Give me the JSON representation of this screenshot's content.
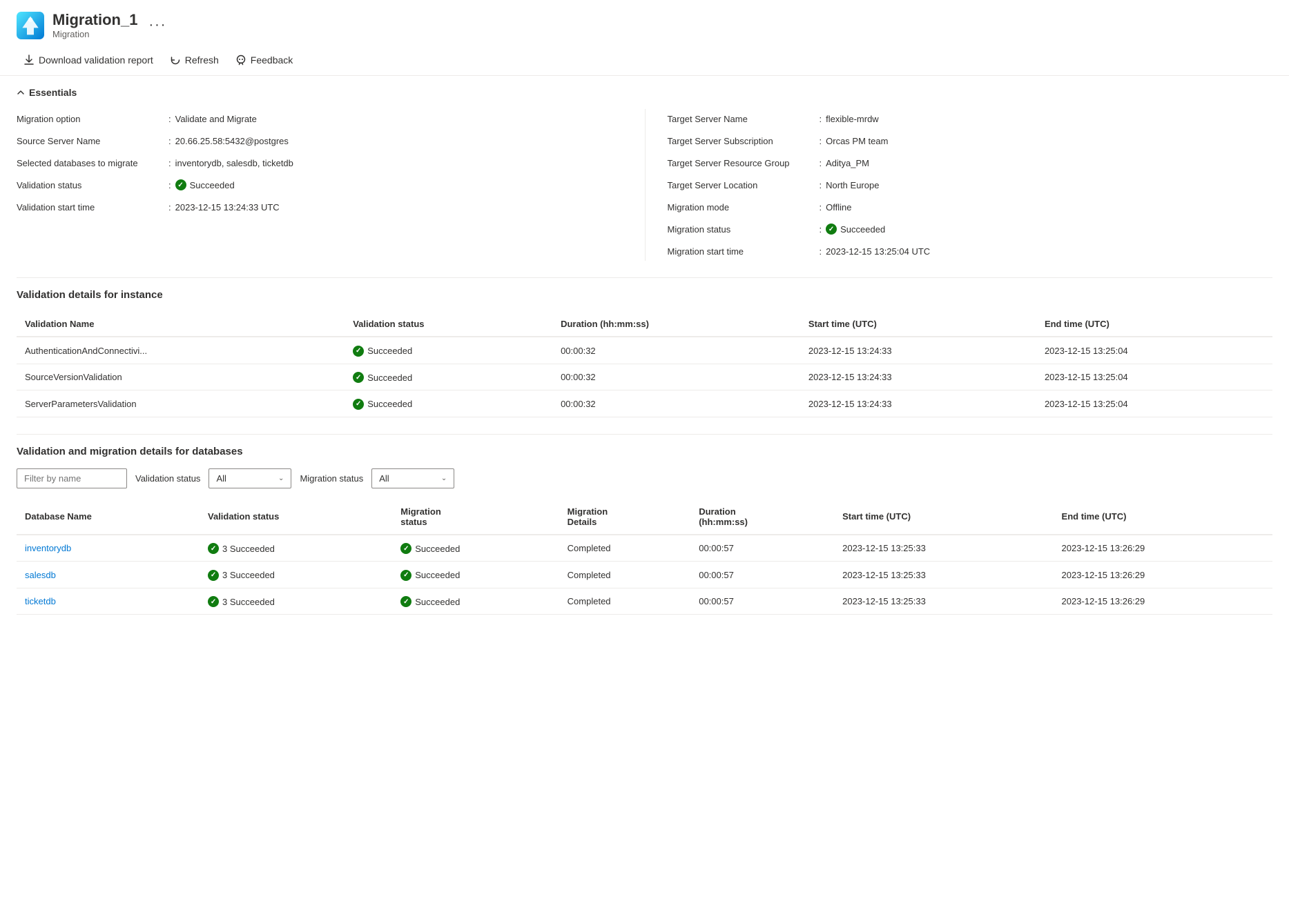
{
  "header": {
    "title": "Migration_1",
    "subtitle": "Migration",
    "ellipsis": "···"
  },
  "toolbar": {
    "download_label": "Download validation report",
    "refresh_label": "Refresh",
    "feedback_label": "Feedback"
  },
  "essentials": {
    "section_label": "Essentials",
    "left": [
      {
        "label": "Migration option",
        "value": "Validate and Migrate"
      },
      {
        "label": "Source Server Name",
        "value": "20.66.25.58:5432@postgres"
      },
      {
        "label": "Selected databases to migrate",
        "value": "inventorydb, salesdb, ticketdb"
      },
      {
        "label": "Validation status",
        "value": "Succeeded",
        "is_badge": true
      },
      {
        "label": "Validation start time",
        "value": "2023-12-15 13:24:33 UTC"
      }
    ],
    "right": [
      {
        "label": "Target Server Name",
        "value": "flexible-mrdw"
      },
      {
        "label": "Target Server Subscription",
        "value": "Orcas PM team"
      },
      {
        "label": "Target Server Resource Group",
        "value": "Aditya_PM"
      },
      {
        "label": "Target Server Location",
        "value": "North Europe"
      },
      {
        "label": "Migration mode",
        "value": "Offline"
      },
      {
        "label": "Migration status",
        "value": "Succeeded",
        "is_badge": true
      },
      {
        "label": "Migration start time",
        "value": "2023-12-15 13:25:04 UTC"
      }
    ]
  },
  "validation_instance": {
    "section_title": "Validation details for instance",
    "columns": [
      "Validation Name",
      "Validation status",
      "Duration (hh:mm:ss)",
      "Start time (UTC)",
      "End time (UTC)"
    ],
    "rows": [
      {
        "name": "AuthenticationAndConnectivi...",
        "status": "Succeeded",
        "duration": "00:00:32",
        "start_time": "2023-12-15 13:24:33",
        "end_time": "2023-12-15 13:25:04"
      },
      {
        "name": "SourceVersionValidation",
        "status": "Succeeded",
        "duration": "00:00:32",
        "start_time": "2023-12-15 13:24:33",
        "end_time": "2023-12-15 13:25:04"
      },
      {
        "name": "ServerParametersValidation",
        "status": "Succeeded",
        "duration": "00:00:32",
        "start_time": "2023-12-15 13:24:33",
        "end_time": "2023-12-15 13:25:04"
      }
    ]
  },
  "validation_databases": {
    "section_title": "Validation and migration details for databases",
    "filter_placeholder": "Filter by name",
    "validation_status_label": "Validation status",
    "validation_status_value": "All",
    "migration_status_label": "Migration status",
    "migration_status_value": "All",
    "columns": [
      "Database Name",
      "Validation status",
      "Migration\nstatus",
      "Migration\nDetails",
      "Duration\n(hh:mm:ss)",
      "Start time (UTC)",
      "End time (UTC)"
    ],
    "rows": [
      {
        "name": "inventorydb",
        "validation_status": "3 Succeeded",
        "migration_status": "Succeeded",
        "migration_details": "Completed",
        "duration": "00:00:57",
        "start_time": "2023-12-15 13:25:33",
        "end_time": "2023-12-15 13:26:29"
      },
      {
        "name": "salesdb",
        "validation_status": "3 Succeeded",
        "migration_status": "Succeeded",
        "migration_details": "Completed",
        "duration": "00:00:57",
        "start_time": "2023-12-15 13:25:33",
        "end_time": "2023-12-15 13:26:29"
      },
      {
        "name": "ticketdb",
        "validation_status": "3 Succeeded",
        "migration_status": "Succeeded",
        "migration_details": "Completed",
        "duration": "00:00:57",
        "start_time": "2023-12-15 13:25:33",
        "end_time": "2023-12-15 13:26:29"
      }
    ]
  },
  "colors": {
    "success": "#107c10",
    "link": "#0078d4",
    "accent": "#0078d4"
  }
}
